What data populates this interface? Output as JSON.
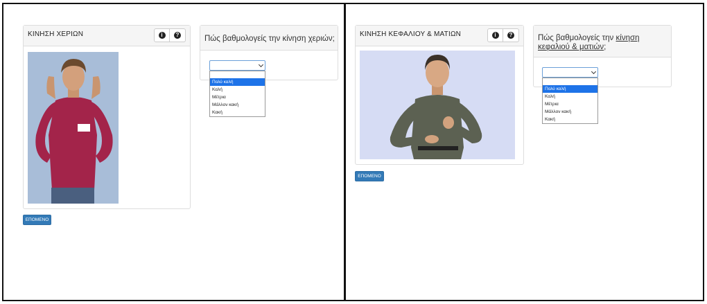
{
  "left": {
    "panel_title": "ΚΙΝΗΣΗ ΧΕΡΙΩΝ",
    "question_prefix": "Πώς βαθμολογείς την κίνηση χεριών;",
    "select_value": "",
    "options": [
      "Πολύ καλή",
      "Καλή",
      "Μέτρια",
      "Μάλλον κακή",
      "Κακή"
    ],
    "selected_option": "Πολύ καλή",
    "next_label": "ΕΠΟΜΕΝΟ"
  },
  "right": {
    "panel_title": "ΚΙΝΗΣΗ ΚΕΦΑΛΙΟΥ & ΜΑΤΙΩΝ",
    "question_prefix": "Πώς βαθμολογείς την ",
    "question_link": "κίνηση κεφαλιού & ματιών",
    "question_suffix": ";",
    "select_value": "",
    "options": [
      "Πολύ καλή",
      "Καλή",
      "Μέτρια",
      "Μάλλον κακή",
      "Κακή"
    ],
    "selected_option": "Πολύ καλή",
    "next_label": "ΕΠΟΜΕΝΟ"
  },
  "icons": [
    "info-icon",
    "help-icon"
  ],
  "colors": {
    "primary": "#337ab7",
    "highlight": "#1e73e8",
    "video_bg_left": "#a8bdd8",
    "video_bg_right": "#d6dcf4"
  }
}
